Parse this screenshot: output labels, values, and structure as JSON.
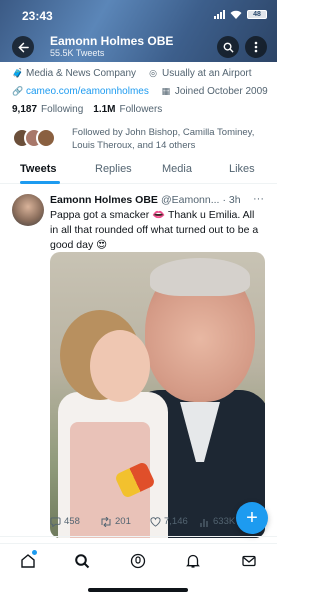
{
  "status_bar": {
    "time": "23:43",
    "battery": "48"
  },
  "header": {
    "name": "Eamonn Holmes OBE",
    "tweet_count": "55.5K Tweets"
  },
  "profile": {
    "category": "Media & News Company",
    "location": "Usually at an Airport",
    "website": "cameo.com/eamonnholmes",
    "joined": "Joined October 2009",
    "following_count": "9,187",
    "following_label": "Following",
    "followers_count": "1.1M",
    "followers_label": "Followers",
    "followed_by": "Followed by John Bishop, Camilla Tominey, Louis Theroux, and 14 others"
  },
  "tabs": [
    {
      "label": "Tweets"
    },
    {
      "label": "Replies"
    },
    {
      "label": "Media"
    },
    {
      "label": "Likes"
    }
  ],
  "tweet": {
    "name": "Eamonn Holmes OBE",
    "handle": "@Eamonn...",
    "time": "· 3h",
    "text": "Pappa got a smacker 👄 Thank u Emilia. All in all that rounded off what turned out to be a good day 😍",
    "replies": "458",
    "retweets": "201",
    "likes": "7,146",
    "views": "633K"
  },
  "colors": {
    "accent": "#1d9bf0",
    "text": "#0f1419",
    "muted": "#536471"
  }
}
